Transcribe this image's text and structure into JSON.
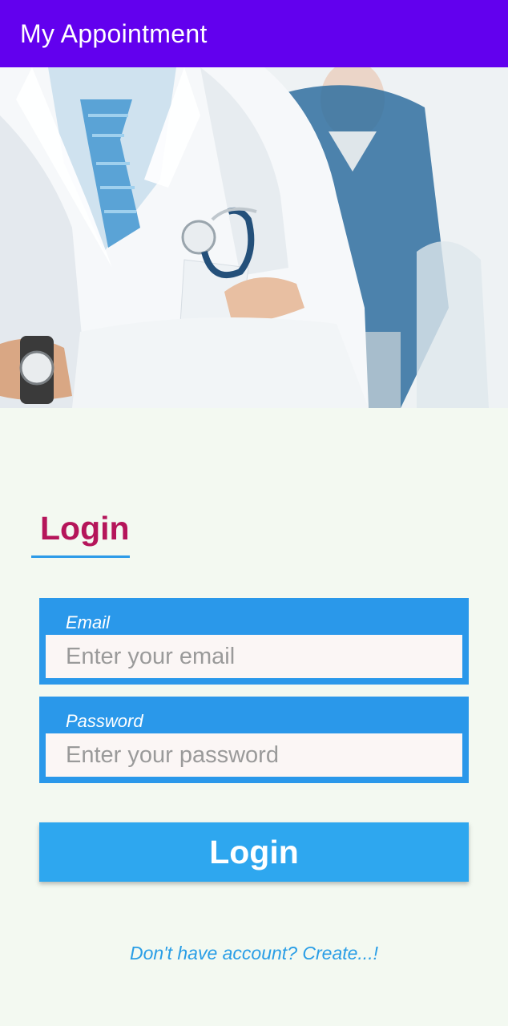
{
  "app_bar": {
    "title": "My Appointment",
    "background_color": "#6200EE"
  },
  "hero_image": {
    "description_icon": "doctor-photo"
  },
  "login_form": {
    "heading": "Login",
    "heading_color": "#B5155A",
    "email": {
      "label": "Email",
      "placeholder": "Enter your email",
      "value": ""
    },
    "password": {
      "label": "Password",
      "placeholder": "Enter your password",
      "value": ""
    },
    "submit_label": "Login",
    "create_account_link": "Don't have account? Create...!"
  },
  "colors": {
    "field_background": "#2A98EA",
    "button_background": "#2EA7EF",
    "page_background": "#F3F9F1"
  }
}
